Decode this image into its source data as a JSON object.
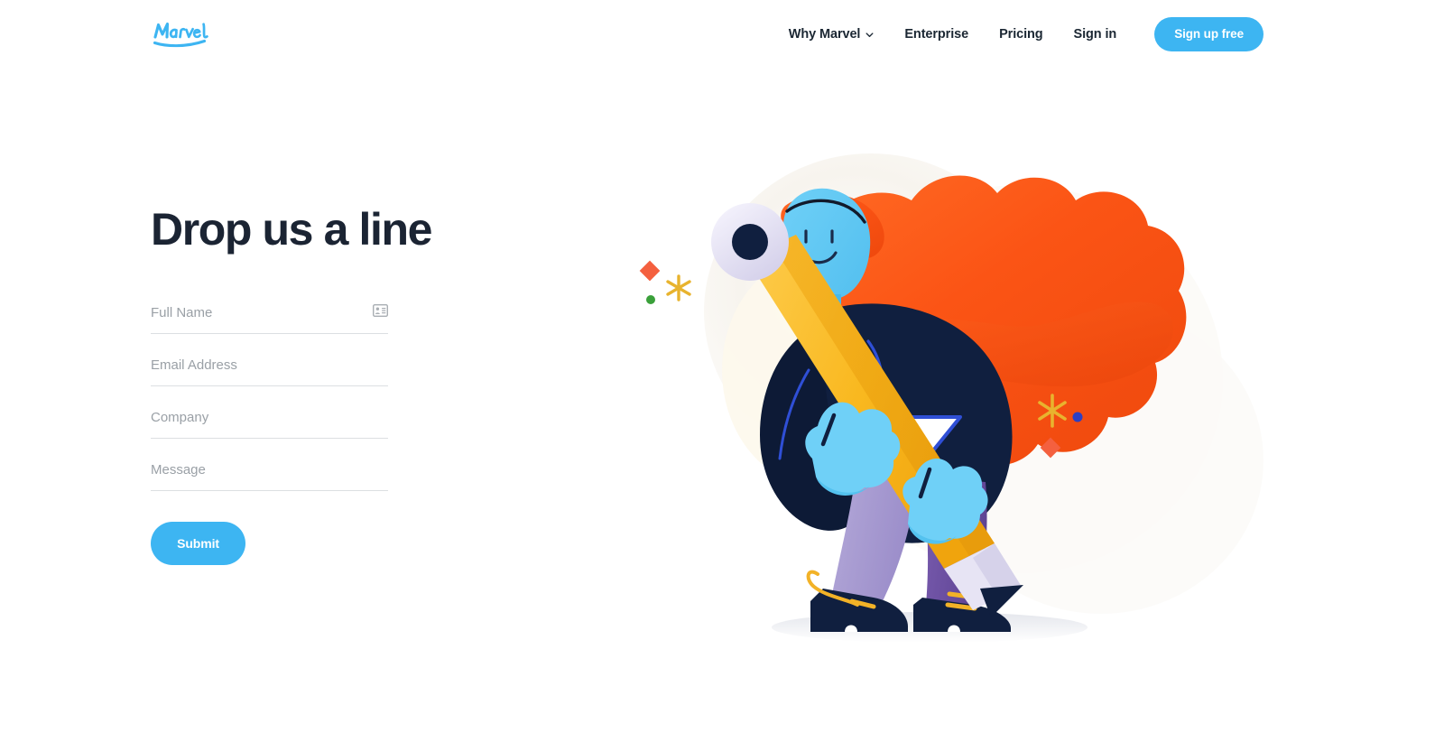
{
  "brand": {
    "logo_text": "Marvel",
    "logo_color": "#3db5f2"
  },
  "header": {
    "nav": [
      {
        "label": "Why Marvel",
        "has_dropdown": true,
        "icon": "chevron-down-icon"
      },
      {
        "label": "Enterprise",
        "has_dropdown": false
      },
      {
        "label": "Pricing",
        "has_dropdown": false
      },
      {
        "label": "Sign in",
        "has_dropdown": false
      }
    ],
    "cta": {
      "label": "Sign up free",
      "bg_color": "#3db5f2",
      "text_color": "#ffffff"
    }
  },
  "main": {
    "title": "Drop us a line",
    "title_color": "#1b2433",
    "form": {
      "fields": [
        {
          "name": "full-name",
          "placeholder": "Full Name",
          "value": "",
          "icon": "contact-card-icon"
        },
        {
          "name": "email",
          "placeholder": "Email Address",
          "value": "",
          "icon": null
        },
        {
          "name": "company",
          "placeholder": "Company",
          "value": "",
          "icon": null
        },
        {
          "name": "message",
          "placeholder": "Message",
          "value": "",
          "icon": null
        }
      ],
      "submit": {
        "label": "Submit",
        "bg_color": "#3db5f2",
        "text_color": "#ffffff"
      }
    }
  },
  "illustration": {
    "description": "Character with long flowing orange hair carrying a large yellow pencil",
    "colors": {
      "hair_orange": "#fb5415",
      "hair_orange_light": "#ff6a2b",
      "skin_blue": "#5ec8f4",
      "skin_blue_dark": "#46b6e8",
      "jacket_navy": "#101f3f",
      "trousers_purple": "#6b4fa0",
      "trousers_purple_light": "#a79ad0",
      "pencil_yellow": "#f9b621",
      "pencil_yellow_light": "#fdcb49",
      "eraser_lavender": "#dedbf0",
      "accent_blue_line": "#2f4fd6",
      "dot_green": "#3aa03a",
      "dot_blue": "#2b3fc4",
      "diamond_orange": "#f4603f",
      "star_yellow": "#e8b32e",
      "ground_gray": "#e9eaee",
      "blob_cream": "#faf6ef"
    }
  }
}
